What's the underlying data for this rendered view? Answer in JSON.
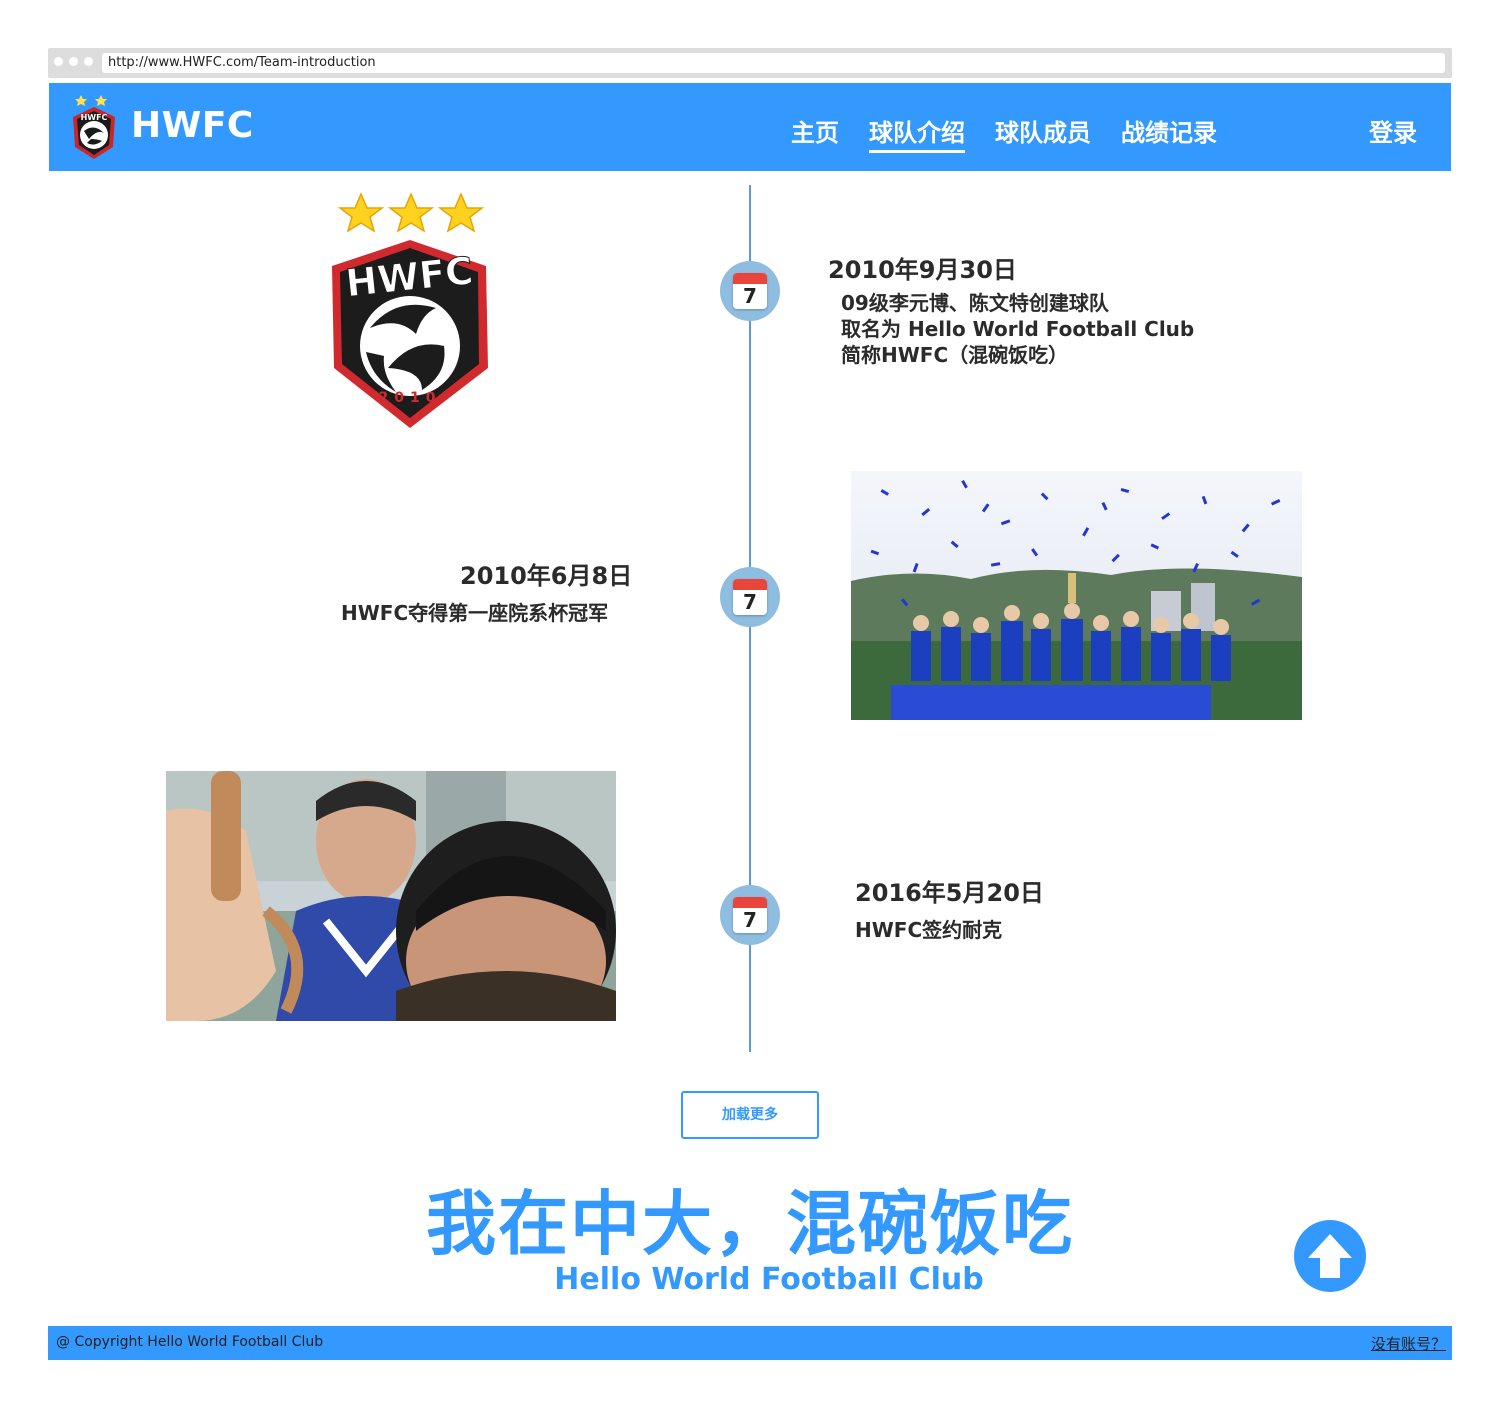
{
  "browser": {
    "url": "http://www.HWFC.com/Team-introduction"
  },
  "header": {
    "brand": "HWFC",
    "nav": [
      {
        "label": "主页",
        "active": false
      },
      {
        "label": "球队介绍",
        "active": true
      },
      {
        "label": "球队成员",
        "active": false
      },
      {
        "label": "战绩记录",
        "active": false
      }
    ],
    "login": "登录"
  },
  "crest": {
    "text": "HWFC",
    "year": "2010"
  },
  "timeline": [
    {
      "calendar_day": "7",
      "date": "2010年9月30日",
      "lines": [
        "09级李元博、陈文特创建球队",
        "取名为 Hello World Football Club",
        "简称HWFC（混碗饭吃）"
      ]
    },
    {
      "calendar_day": "7",
      "date": "2010年6月8日",
      "lines": [
        "HWFC夺得第一座院系杯冠军"
      ]
    },
    {
      "calendar_day": "7",
      "date": "2016年5月20日",
      "lines": [
        "HWFC签约耐克"
      ]
    }
  ],
  "load_more": "加载更多",
  "slogan": {
    "main": "我在中大，混碗饭吃",
    "sub": "Hello World Football Club"
  },
  "footer": {
    "copyright": "@ Copyright Hello World Football Club",
    "no_account": "没有账号？"
  },
  "colors": {
    "primary": "#3399ff",
    "timeline_line": "#5a9bd8",
    "calendar_circle": "#8fbde0",
    "calendar_top": "#e8453c"
  }
}
